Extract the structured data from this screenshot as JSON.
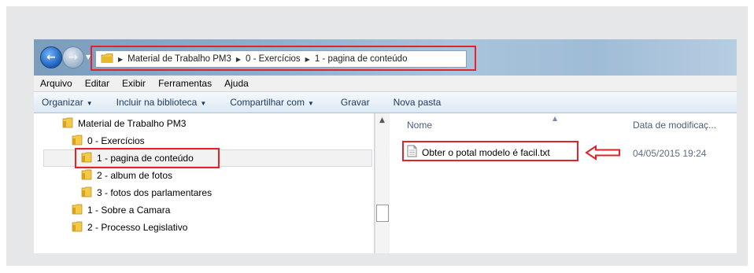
{
  "breadcrumb": [
    "Material de Trabalho PM3",
    "0 - Exercícios",
    "1 - pagina de conteúdo"
  ],
  "menubar": {
    "arquivo": "Arquivo",
    "editar": "Editar",
    "exibir": "Exibir",
    "ferramentas": "Ferramentas",
    "ajuda": "Ajuda"
  },
  "toolbar": {
    "organizar": "Organizar",
    "incluir": "Incluir na biblioteca",
    "compartilhar": "Compartilhar com",
    "gravar": "Gravar",
    "nova_pasta": "Nova pasta"
  },
  "tree": [
    {
      "label": "Material de Trabalho PM3"
    },
    {
      "label": "0 - Exercícios"
    },
    {
      "label": "1 - pagina de conteúdo",
      "selected": true
    },
    {
      "label": "2 - album de fotos"
    },
    {
      "label": "3 - fotos dos parlamentares"
    },
    {
      "label": "1 - Sobre a Camara"
    },
    {
      "label": "2 - Processo Legislativo"
    }
  ],
  "columns": {
    "name": "Nome",
    "date": "Data de modificaç..."
  },
  "files": [
    {
      "name": "Obter o potal modelo é facil.txt",
      "date": "04/05/2015 19:24"
    }
  ],
  "icons": {
    "back": "back-arrow-icon",
    "forward": "forward-arrow-icon",
    "folder": "folder-icon",
    "file": "text-file-icon",
    "annotation": "red-arrow-icon"
  },
  "colors": {
    "highlight": "#e0242a",
    "folder": "#e8b92f",
    "titlebar": "#8eb0cf"
  }
}
